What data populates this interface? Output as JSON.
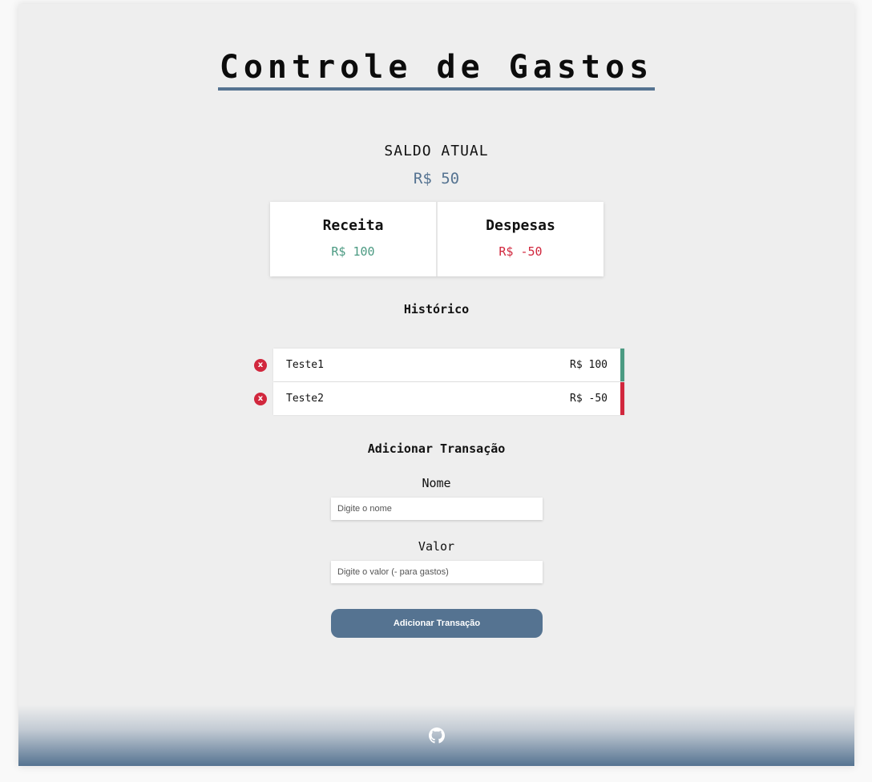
{
  "header": {
    "title": "Controle de Gastos"
  },
  "balance": {
    "label": "SALDO ATUAL",
    "value": "R$ 50"
  },
  "summary": {
    "income_label": "Receita",
    "income_value": "R$ 100",
    "expense_label": "Despesas",
    "expense_value": "R$ -50"
  },
  "history": {
    "title": "Histórico",
    "items": [
      {
        "delete_label": "x",
        "name": "Teste1",
        "amount": "R$ 100",
        "type": "income"
      },
      {
        "delete_label": "x",
        "name": "Teste2",
        "amount": "R$ -50",
        "type": "expense"
      }
    ]
  },
  "form": {
    "title": "Adicionar Transação",
    "name_label": "Nome",
    "name_placeholder": "Digite o nome",
    "value_label": "Valor",
    "value_placeholder": "Digite o valor (- para gastos)",
    "submit_label": "Adicionar Transação"
  },
  "footer": {
    "icon": "github-icon"
  },
  "colors": {
    "accent": "#557391",
    "income": "#4b9a82",
    "expense": "#d1273d",
    "background": "#eeeeee"
  }
}
